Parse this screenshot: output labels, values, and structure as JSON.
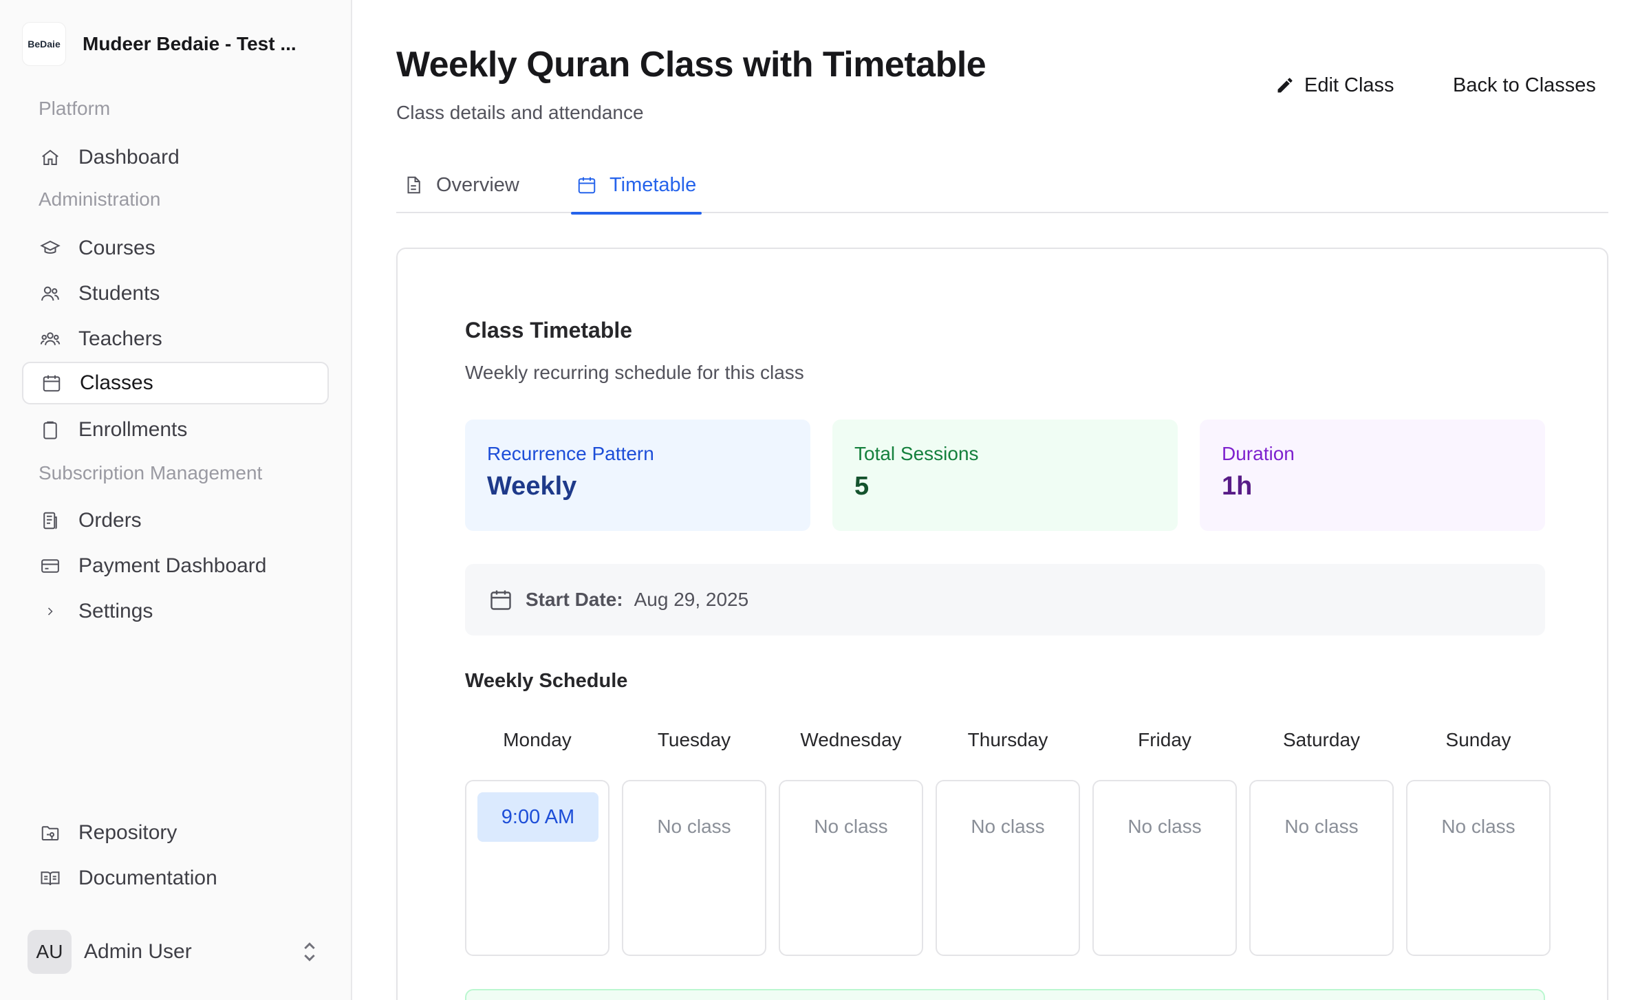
{
  "sidebar": {
    "brand": {
      "logo_text": "BeDaie",
      "name": "Mudeer Bedaie - Test ..."
    },
    "groups": {
      "platform": "Platform",
      "administration": "Administration",
      "subscription": "Subscription Management"
    },
    "items": {
      "dashboard": "Dashboard",
      "courses": "Courses",
      "students": "Students",
      "teachers": "Teachers",
      "classes": "Classes",
      "enrollments": "Enrollments",
      "orders": "Orders",
      "payment_dashboard": "Payment Dashboard",
      "settings": "Settings",
      "repository": "Repository",
      "documentation": "Documentation"
    },
    "active_item": "classes",
    "user": {
      "initials": "AU",
      "name": "Admin User"
    }
  },
  "header": {
    "title": "Weekly Quran Class with Timetable",
    "subtitle": "Class details and attendance",
    "edit_label": "Edit Class",
    "back_label": "Back to Classes"
  },
  "tabs": [
    {
      "label": "Overview",
      "icon": "document-icon",
      "active": false
    },
    {
      "label": "Timetable",
      "icon": "calendar-icon",
      "active": true
    }
  ],
  "timetable": {
    "title": "Class Timetable",
    "subtitle": "Weekly recurring schedule for this class",
    "stats": {
      "pattern": {
        "label": "Recurrence Pattern",
        "value": "Weekly"
      },
      "sessions": {
        "label": "Total Sessions",
        "value": "5"
      },
      "duration": {
        "label": "Duration",
        "value": "1h"
      }
    },
    "start_date": {
      "label": "Start Date:",
      "value": "Aug 29, 2025"
    },
    "schedule_title": "Weekly Schedule",
    "days": [
      {
        "name": "Monday",
        "time": "9:00 AM",
        "empty_text": ""
      },
      {
        "name": "Tuesday",
        "time": "",
        "empty_text": "No class"
      },
      {
        "name": "Wednesday",
        "time": "",
        "empty_text": "No class"
      },
      {
        "name": "Thursday",
        "time": "",
        "empty_text": "No class"
      },
      {
        "name": "Friday",
        "time": "",
        "empty_text": "No class"
      },
      {
        "name": "Saturday",
        "time": "",
        "empty_text": "No class"
      },
      {
        "name": "Sunday",
        "time": "",
        "empty_text": "No class"
      }
    ]
  },
  "colors": {
    "accent": "#2563eb",
    "pattern_bg": "#eff6ff",
    "sessions_bg": "#f0fdf4",
    "duration_bg": "#faf5ff"
  }
}
